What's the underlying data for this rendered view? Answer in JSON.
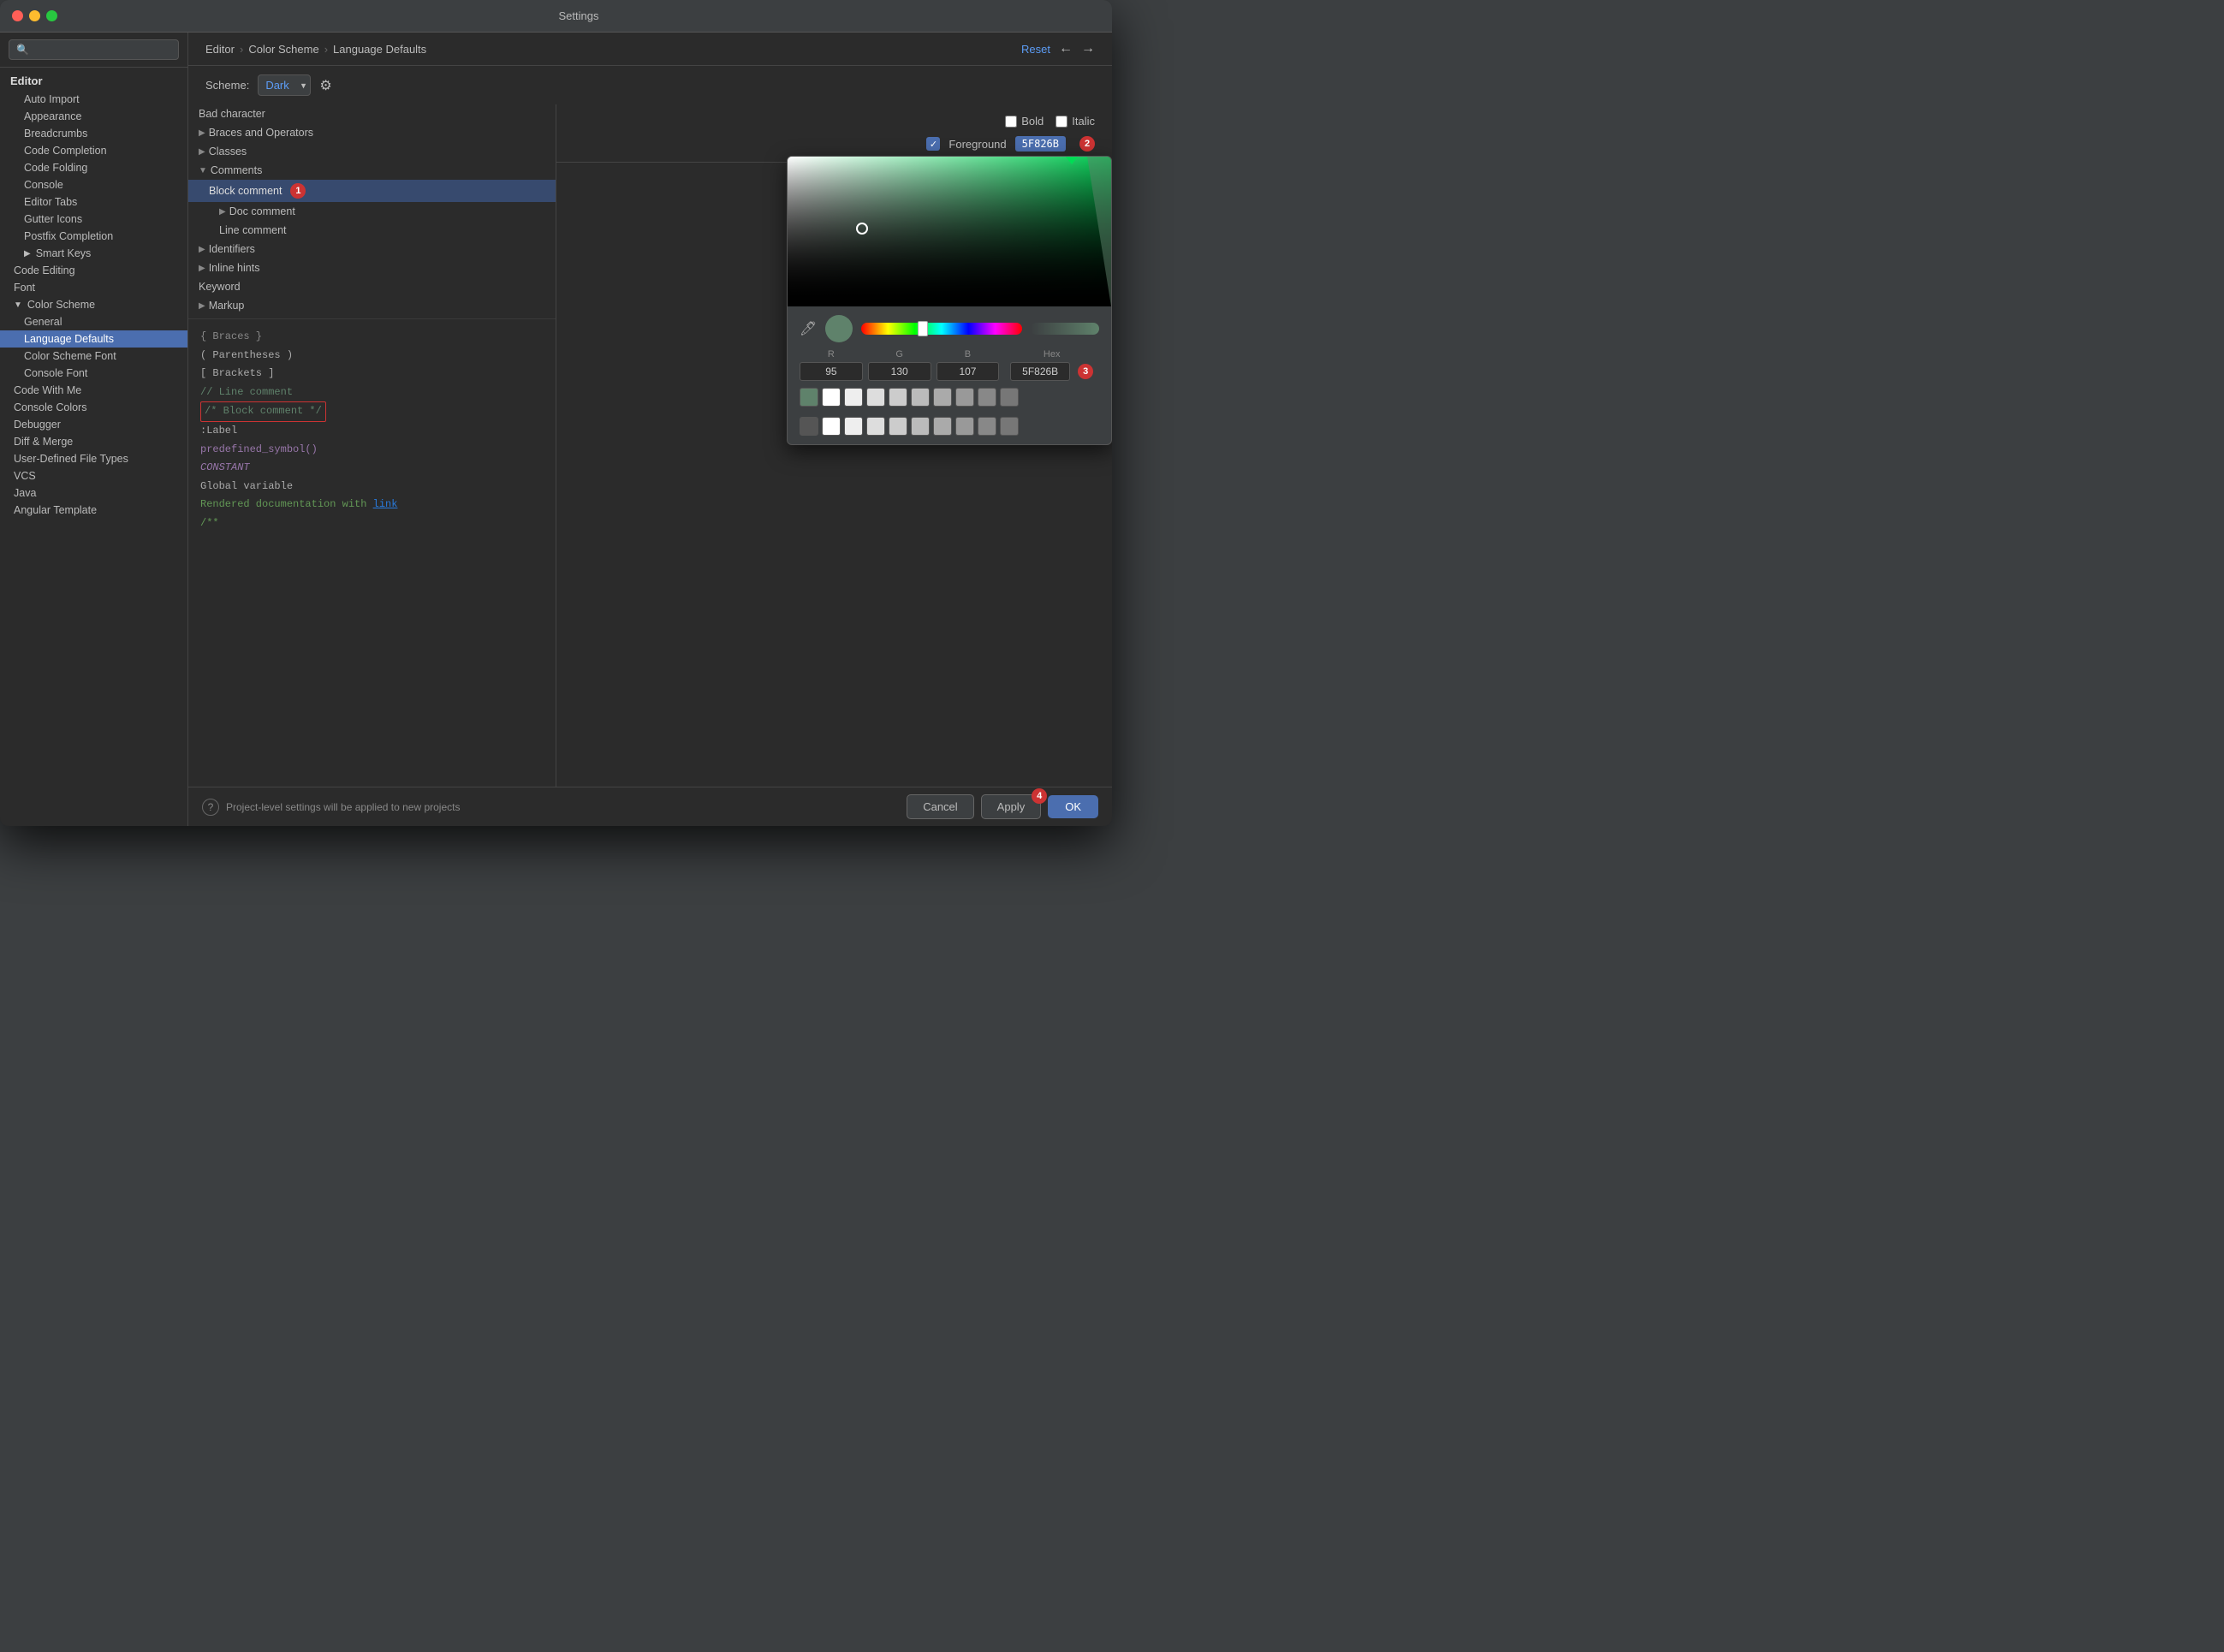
{
  "window": {
    "title": "Settings"
  },
  "sidebar": {
    "search_placeholder": "🔍",
    "section": "Editor",
    "items": [
      {
        "label": "Auto Import",
        "indent": 1,
        "active": false
      },
      {
        "label": "Appearance",
        "indent": 1,
        "active": false
      },
      {
        "label": "Breadcrumbs",
        "indent": 1,
        "active": false
      },
      {
        "label": "Code Completion",
        "indent": 1,
        "active": false
      },
      {
        "label": "Code Folding",
        "indent": 1,
        "active": false
      },
      {
        "label": "Console",
        "indent": 1,
        "active": false
      },
      {
        "label": "Editor Tabs",
        "indent": 1,
        "active": false
      },
      {
        "label": "Gutter Icons",
        "indent": 1,
        "active": false
      },
      {
        "label": "Postfix Completion",
        "indent": 1,
        "active": false
      },
      {
        "label": "Smart Keys",
        "indent": 1,
        "active": false,
        "has_arrow": true
      },
      {
        "label": "Code Editing",
        "indent": 0,
        "active": false
      },
      {
        "label": "Font",
        "indent": 0,
        "active": false
      },
      {
        "label": "Color Scheme",
        "indent": 0,
        "active": false,
        "expanded": true
      },
      {
        "label": "General",
        "indent": 1,
        "active": false
      },
      {
        "label": "Language Defaults",
        "indent": 1,
        "active": true
      },
      {
        "label": "Color Scheme Font",
        "indent": 1,
        "active": false
      },
      {
        "label": "Console Font",
        "indent": 1,
        "active": false
      },
      {
        "label": "Code With Me",
        "indent": 0,
        "active": false
      },
      {
        "label": "Console Colors",
        "indent": 0,
        "active": false
      },
      {
        "label": "Debugger",
        "indent": 0,
        "active": false
      },
      {
        "label": "Diff & Merge",
        "indent": 0,
        "active": false
      },
      {
        "label": "User-Defined File Types",
        "indent": 0,
        "active": false
      },
      {
        "label": "VCS",
        "indent": 0,
        "active": false
      },
      {
        "label": "Java",
        "indent": 0,
        "active": false
      },
      {
        "label": "Angular Template",
        "indent": 0,
        "active": false
      }
    ]
  },
  "header": {
    "breadcrumb": [
      "Editor",
      "Color Scheme",
      "Language Defaults"
    ],
    "reset_label": "Reset",
    "back_label": "←",
    "forward_label": "→"
  },
  "scheme": {
    "label": "Scheme:",
    "value": "Dark"
  },
  "tree": {
    "items": [
      {
        "label": "Bad character",
        "indent": 0
      },
      {
        "label": "Braces and Operators",
        "indent": 0,
        "has_arrow": true
      },
      {
        "label": "Classes",
        "indent": 0,
        "has_arrow": true
      },
      {
        "label": "Comments",
        "indent": 0,
        "expanded": true
      },
      {
        "label": "Block comment",
        "indent": 1,
        "active": true,
        "badge": "1"
      },
      {
        "label": "Doc comment",
        "indent": 2,
        "has_arrow": true
      },
      {
        "label": "Line comment",
        "indent": 2
      },
      {
        "label": "Identifiers",
        "indent": 0,
        "has_arrow": true
      },
      {
        "label": "Inline hints",
        "indent": 0,
        "has_arrow": true
      },
      {
        "label": "Keyword",
        "indent": 0
      },
      {
        "label": "Markup",
        "indent": 0,
        "has_arrow": true
      },
      {
        "label": "{ Braces }",
        "indent": 0
      },
      {
        "label": "( Parentheses )",
        "indent": 0
      },
      {
        "label": "[ Brackets ]",
        "indent": 0
      }
    ]
  },
  "color_controls": {
    "bold_label": "Bold",
    "italic_label": "Italic",
    "foreground_label": "Foreground",
    "foreground_hex": "5F826B",
    "badge2": "2"
  },
  "color_picker": {
    "r": "95",
    "g": "130",
    "b": "107",
    "hex": "5F826B",
    "badge3": "3",
    "swatches_row1": [
      "#4a4a4a",
      "#ffffff",
      "#eeeeee",
      "#dddddd",
      "#cccccc",
      "#bbbbbb",
      "#aaaaaa",
      "#999999",
      "#888888",
      "#777777"
    ],
    "swatches_row2": [
      "#5F826B",
      "#ffffff",
      "#eeeeee",
      "#dddddd",
      "#cccccc",
      "#bbbbbb",
      "#aaaaaa",
      "#999999",
      "#888888",
      "#777777"
    ]
  },
  "code_preview": {
    "lines": [
      {
        "text": "// Line comment",
        "type": "comment"
      },
      {
        "text": "/* Block comment */",
        "type": "block_comment_highlighted"
      },
      {
        "text": ":Label",
        "type": "label"
      },
      {
        "text": "predefined_symbol()",
        "type": "predef"
      },
      {
        "text": "CONSTANT",
        "type": "constant"
      },
      {
        "text": "Global variable",
        "type": "global"
      },
      {
        "text": "Rendered documentation with link",
        "type": "doc_link"
      },
      {
        "text": "/**",
        "type": "doc"
      }
    ]
  },
  "bottom_bar": {
    "help_text": "Project-level settings will be applied to new projects",
    "cancel_label": "Cancel",
    "apply_label": "Apply",
    "ok_label": "OK",
    "badge4": "4"
  }
}
